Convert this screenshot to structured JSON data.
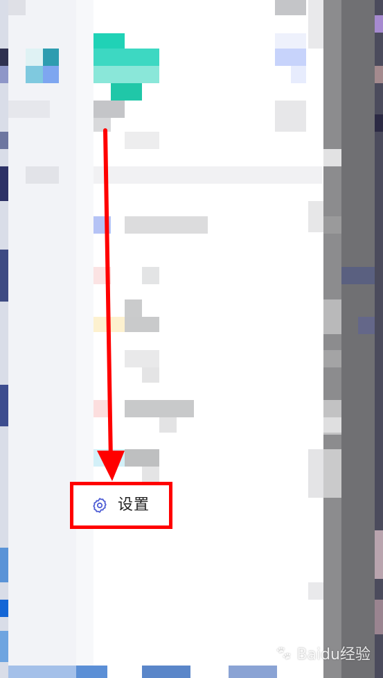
{
  "settings_item": {
    "icon": "gear-icon",
    "label": "设置",
    "icon_color": "#4c5bd4"
  },
  "annotation": {
    "color": "#ff0000"
  },
  "watermark": {
    "text": "Baidu经验",
    "icon": "paw-icon"
  }
}
